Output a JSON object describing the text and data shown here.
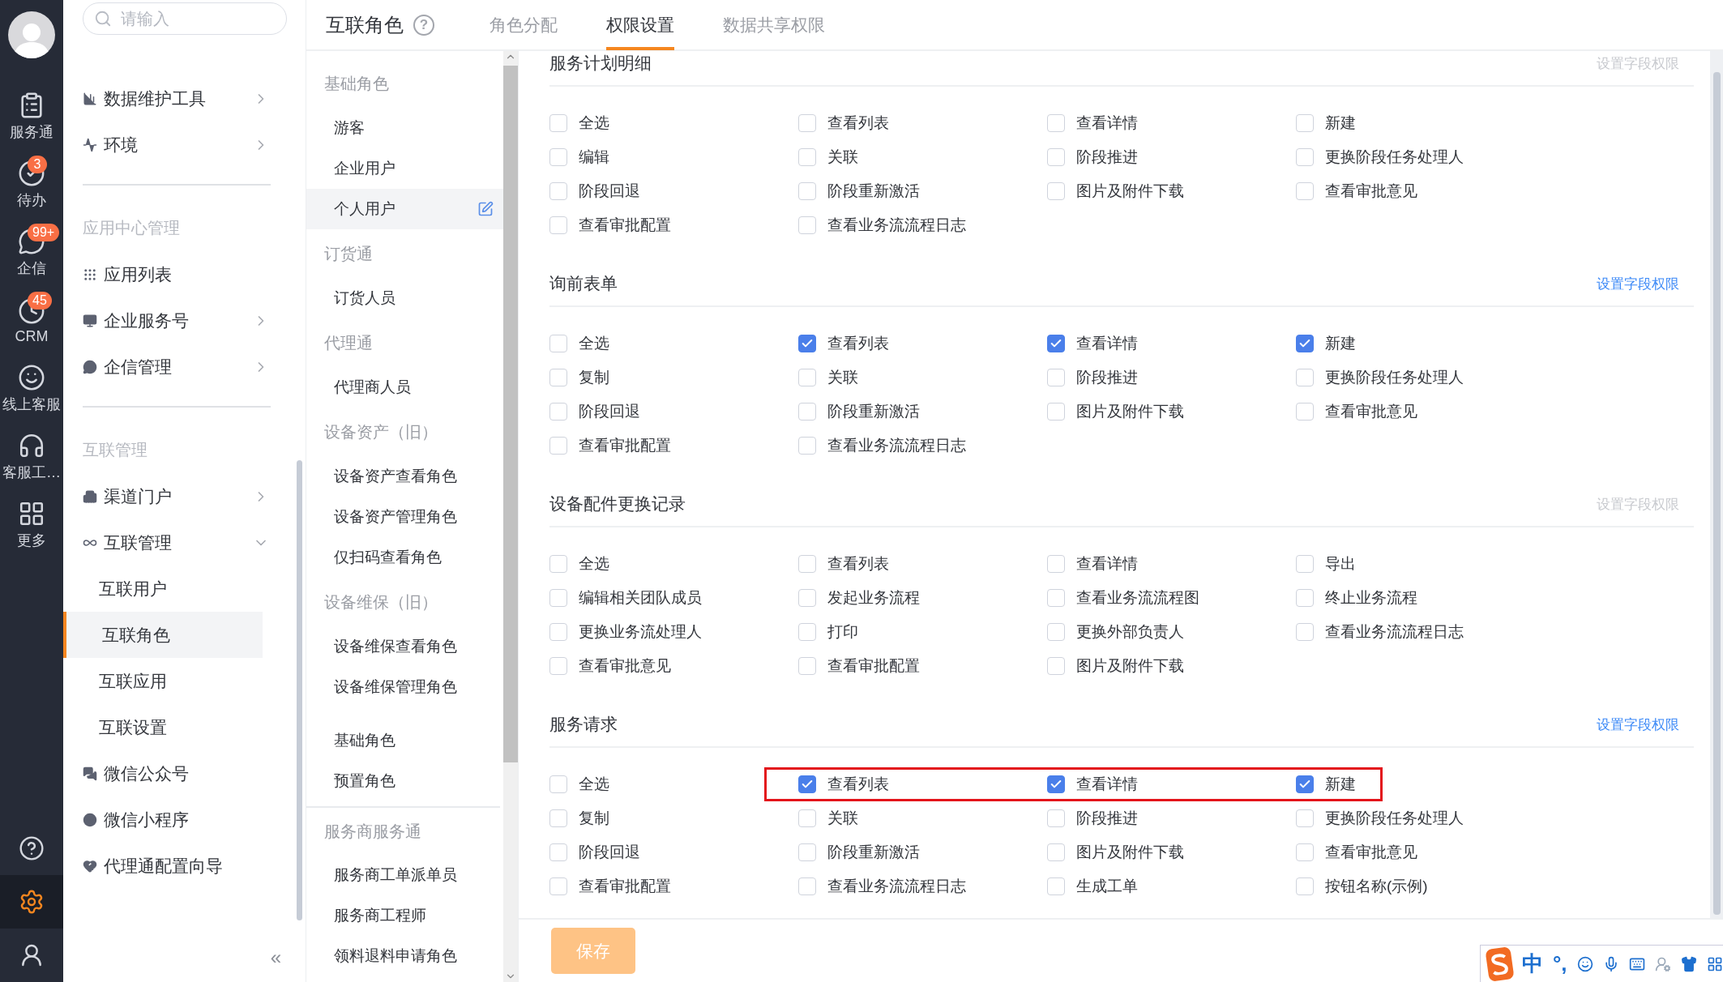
{
  "rail": {
    "items": [
      {
        "label": "服务通"
      },
      {
        "label": "待办",
        "badge": "3"
      },
      {
        "label": "企信",
        "badge": "99+"
      },
      {
        "label": "CRM",
        "badge": "45"
      },
      {
        "label": "线上客服"
      },
      {
        "label": "客服工…"
      },
      {
        "label": "更多"
      }
    ],
    "bottom": [
      {
        "selected": false
      },
      {
        "selected": true
      },
      {
        "selected": false
      }
    ]
  },
  "sidebar": {
    "search": {
      "placeholder": "请输入"
    },
    "groups": [
      {
        "items": [
          {
            "label": "数据维护工具",
            "expanded": false,
            "selected": false
          },
          {
            "label": "环境",
            "expanded": false,
            "selected": false
          }
        ]
      },
      {
        "heading": "应用中心管理",
        "items": [
          {
            "label": "应用列表",
            "selected": false
          },
          {
            "label": "企业服务号",
            "expanded": false,
            "selected": false
          },
          {
            "label": "企信管理",
            "expanded": false,
            "selected": false
          }
        ]
      },
      {
        "heading": "互联管理",
        "items": [
          {
            "label": "渠道门户",
            "expanded": false,
            "selected": false
          },
          {
            "label": "互联管理",
            "expanded": true,
            "selected": false,
            "children": [
              {
                "label": "互联用户",
                "selected": false
              },
              {
                "label": "互联角色",
                "selected": true
              },
              {
                "label": "互联应用",
                "selected": false
              },
              {
                "label": "互联设置",
                "selected": false
              }
            ]
          },
          {
            "label": "微信公众号",
            "selected": false
          },
          {
            "label": "微信小程序",
            "selected": false
          },
          {
            "label": "代理通配置向导",
            "selected": false
          }
        ]
      }
    ],
    "collapse": "«"
  },
  "header": {
    "title": "互联角色",
    "help": "?",
    "tabs": [
      {
        "label": "角色分配",
        "selected": false
      },
      {
        "label": "权限设置",
        "selected": true
      },
      {
        "label": "数据共享权限",
        "selected": false
      }
    ]
  },
  "roles": [
    {
      "heading": "基础角色",
      "items": [
        {
          "label": "游客",
          "selected": false
        },
        {
          "label": "企业用户",
          "selected": false
        },
        {
          "label": "个人用户",
          "selected": true
        }
      ]
    },
    {
      "heading": "订货通",
      "items": [
        {
          "label": "订货人员",
          "selected": false
        }
      ]
    },
    {
      "heading": "代理通",
      "items": [
        {
          "label": "代理商人员",
          "selected": false
        }
      ]
    },
    {
      "heading": "设备资产（旧）",
      "items": [
        {
          "label": "设备资产查看角色",
          "selected": false
        },
        {
          "label": "设备资产管理角色",
          "selected": false
        },
        {
          "label": "仅扫码查看角色",
          "selected": false
        }
      ]
    },
    {
      "heading": "设备维保（旧）",
      "items": [
        {
          "label": "设备维保查看角色",
          "selected": false
        },
        {
          "label": "设备维保管理角色",
          "selected": false
        }
      ]
    },
    {
      "items": [
        {
          "label": "基础角色",
          "selected": false
        },
        {
          "label": "预置角色",
          "selected": false
        }
      ]
    },
    {
      "heading": "服务商服务通",
      "separated": true,
      "items": [
        {
          "label": "服务商工单派单员",
          "selected": false
        },
        {
          "label": "服务商工程师",
          "selected": false
        },
        {
          "label": "领料退料申请角色",
          "selected": false
        }
      ]
    }
  ],
  "sections": [
    {
      "title": "服务计划明细",
      "field_link": {
        "label": "设置字段权限",
        "enabled": false
      },
      "rows": [
        [
          {
            "label": "全选",
            "checked": false,
            "highlighted": false
          },
          {
            "label": "查看列表",
            "checked": false,
            "highlighted": false
          },
          {
            "label": "查看详情",
            "checked": false,
            "highlighted": false
          },
          {
            "label": "新建",
            "checked": false,
            "highlighted": false
          }
        ],
        [
          {
            "label": "编辑",
            "checked": false,
            "highlighted": false
          },
          {
            "label": "关联",
            "checked": false,
            "highlighted": false
          },
          {
            "label": "阶段推进",
            "checked": false,
            "highlighted": false
          },
          {
            "label": "更换阶段任务处理人",
            "checked": false,
            "highlighted": false
          }
        ],
        [
          {
            "label": "阶段回退",
            "checked": false,
            "highlighted": false
          },
          {
            "label": "阶段重新激活",
            "checked": false,
            "highlighted": false
          },
          {
            "label": "图片及附件下载",
            "checked": false,
            "highlighted": false
          },
          {
            "label": "查看审批意见",
            "checked": false,
            "highlighted": false
          }
        ],
        [
          {
            "label": "查看审批配置",
            "checked": false,
            "highlighted": false
          },
          {
            "label": "查看业务流流程日志",
            "checked": false,
            "highlighted": false
          }
        ]
      ]
    },
    {
      "title": "询前表单",
      "field_link": {
        "label": "设置字段权限",
        "enabled": true
      },
      "rows": [
        [
          {
            "label": "全选",
            "checked": false,
            "highlighted": false
          },
          {
            "label": "查看列表",
            "checked": true,
            "highlighted": false
          },
          {
            "label": "查看详情",
            "checked": true,
            "highlighted": false
          },
          {
            "label": "新建",
            "checked": true,
            "highlighted": false
          }
        ],
        [
          {
            "label": "复制",
            "checked": false,
            "highlighted": false
          },
          {
            "label": "关联",
            "checked": false,
            "highlighted": false
          },
          {
            "label": "阶段推进",
            "checked": false,
            "highlighted": false
          },
          {
            "label": "更换阶段任务处理人",
            "checked": false,
            "highlighted": false
          }
        ],
        [
          {
            "label": "阶段回退",
            "checked": false,
            "highlighted": false
          },
          {
            "label": "阶段重新激活",
            "checked": false,
            "highlighted": false
          },
          {
            "label": "图片及附件下载",
            "checked": false,
            "highlighted": false
          },
          {
            "label": "查看审批意见",
            "checked": false,
            "highlighted": false
          }
        ],
        [
          {
            "label": "查看审批配置",
            "checked": false,
            "highlighted": false
          },
          {
            "label": "查看业务流流程日志",
            "checked": false,
            "highlighted": false
          }
        ]
      ]
    },
    {
      "title": "设备配件更换记录",
      "field_link": {
        "label": "设置字段权限",
        "enabled": false
      },
      "rows": [
        [
          {
            "label": "全选",
            "checked": false,
            "highlighted": false
          },
          {
            "label": "查看列表",
            "checked": false,
            "highlighted": false
          },
          {
            "label": "查看详情",
            "checked": false,
            "highlighted": false
          },
          {
            "label": "导出",
            "checked": false,
            "highlighted": false
          }
        ],
        [
          {
            "label": "编辑相关团队成员",
            "checked": false,
            "highlighted": false
          },
          {
            "label": "发起业务流程",
            "checked": false,
            "highlighted": false
          },
          {
            "label": "查看业务流流程图",
            "checked": false,
            "highlighted": false
          },
          {
            "label": "终止业务流程",
            "checked": false,
            "highlighted": false
          }
        ],
        [
          {
            "label": "更换业务流处理人",
            "checked": false,
            "highlighted": false
          },
          {
            "label": "打印",
            "checked": false,
            "highlighted": false
          },
          {
            "label": "更换外部负责人",
            "checked": false,
            "highlighted": false
          },
          {
            "label": "查看业务流流程日志",
            "checked": false,
            "highlighted": false
          }
        ],
        [
          {
            "label": "查看审批意见",
            "checked": false,
            "highlighted": false
          },
          {
            "label": "查看审批配置",
            "checked": false,
            "highlighted": false
          },
          {
            "label": "图片及附件下载",
            "checked": false,
            "highlighted": false
          }
        ]
      ]
    },
    {
      "title": "服务请求",
      "field_link": {
        "label": "设置字段权限",
        "enabled": true
      },
      "rows": [
        [
          {
            "label": "全选",
            "checked": false,
            "highlighted": false
          },
          {
            "label": "查看列表",
            "checked": true,
            "highlighted": true
          },
          {
            "label": "查看详情",
            "checked": true,
            "highlighted": true
          },
          {
            "label": "新建",
            "checked": true,
            "highlighted": true
          }
        ],
        [
          {
            "label": "复制",
            "checked": false,
            "highlighted": false
          },
          {
            "label": "关联",
            "checked": false,
            "highlighted": false
          },
          {
            "label": "阶段推进",
            "checked": false,
            "highlighted": false
          },
          {
            "label": "更换阶段任务处理人",
            "checked": false,
            "highlighted": false
          }
        ],
        [
          {
            "label": "阶段回退",
            "checked": false,
            "highlighted": false
          },
          {
            "label": "阶段重新激活",
            "checked": false,
            "highlighted": false
          },
          {
            "label": "图片及附件下载",
            "checked": false,
            "highlighted": false
          },
          {
            "label": "查看审批意见",
            "checked": false,
            "highlighted": false
          }
        ],
        [
          {
            "label": "查看审批配置",
            "checked": false,
            "highlighted": false
          },
          {
            "label": "查看业务流流程日志",
            "checked": false,
            "highlighted": false
          },
          {
            "label": "生成工单",
            "checked": false,
            "highlighted": false
          },
          {
            "label": "按钮名称(示例)",
            "checked": false,
            "highlighted": false
          }
        ]
      ]
    }
  ],
  "save": {
    "label": "保存",
    "disabled": true
  },
  "ime": {
    "mode": "中",
    "punctuation": "°,"
  }
}
